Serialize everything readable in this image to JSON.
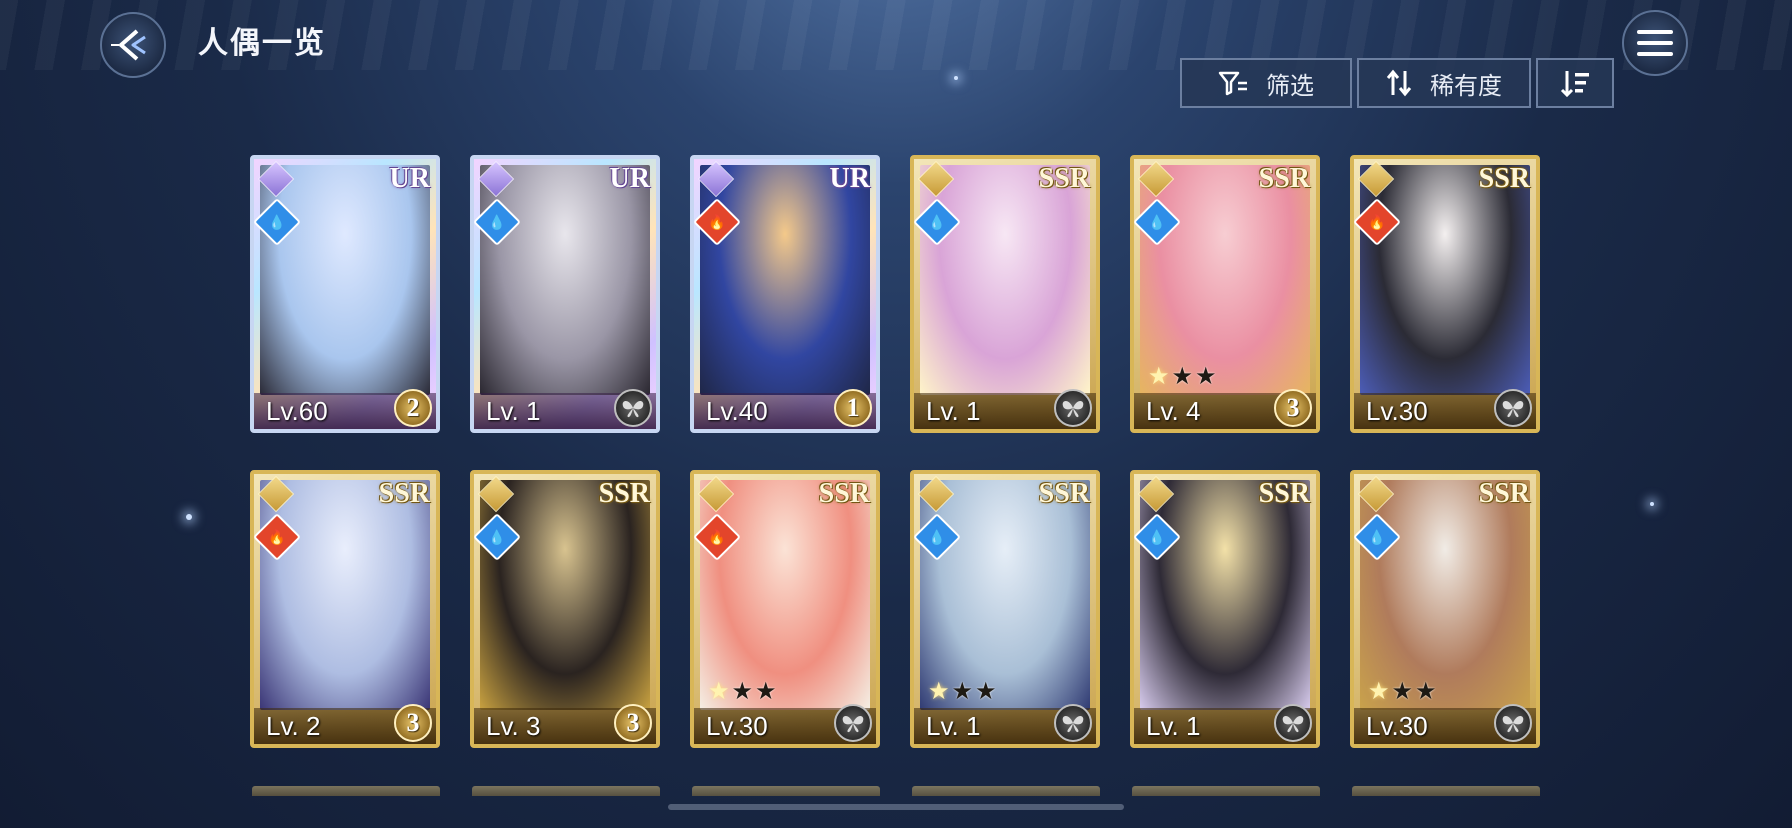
{
  "header": {
    "title": "人偶一览"
  },
  "toolbar": {
    "filter_label": "筛选",
    "sort_label": "稀有度"
  },
  "colors": {
    "gold_frame": "#d8b657",
    "ur_frame": "#c7d6f2",
    "water": "#2f8ee8",
    "fire": "#e3452b"
  },
  "cards": [
    {
      "rarity": "UR",
      "element": "water",
      "level": "Lv.60",
      "emblem": "2",
      "stars": 0,
      "stars_lit": 0,
      "art": [
        "#dfe9ff",
        "#a9c6ee",
        "#2a2a36"
      ]
    },
    {
      "rarity": "UR",
      "element": "water",
      "level": "Lv. 1",
      "emblem": "",
      "stars": 0,
      "stars_lit": 0,
      "art": [
        "#e8e6ec",
        "#9a96a6",
        "#2a2730"
      ]
    },
    {
      "rarity": "UR",
      "element": "fire",
      "level": "Lv.40",
      "emblem": "1",
      "stars": 0,
      "stars_lit": 0,
      "art": [
        "#f4c98a",
        "#3146a1",
        "#1f2747"
      ]
    },
    {
      "rarity": "SSR",
      "element": "water",
      "level": "Lv. 1",
      "emblem": "",
      "stars": 0,
      "stars_lit": 0,
      "art": [
        "#f7e7f4",
        "#d9a4d7",
        "#fff5c9"
      ]
    },
    {
      "rarity": "SSR",
      "element": "water",
      "level": "Lv. 4",
      "emblem": "3",
      "stars": 3,
      "stars_lit": 1,
      "art": [
        "#f7cdd2",
        "#ea8fa2",
        "#e6b65f"
      ]
    },
    {
      "rarity": "SSR",
      "element": "fire",
      "level": "Lv.30",
      "emblem": "",
      "stars": 0,
      "stars_lit": 0,
      "art": [
        "#f4f0f0",
        "#2b2b35",
        "#4c5db8"
      ]
    },
    {
      "rarity": "SSR",
      "element": "fire",
      "level": "Lv. 2",
      "emblem": "3",
      "stars": 0,
      "stars_lit": 0,
      "art": [
        "#e9eefc",
        "#aebde2",
        "#3a3575"
      ]
    },
    {
      "rarity": "SSR",
      "element": "water",
      "level": "Lv. 3",
      "emblem": "3",
      "stars": 0,
      "stars_lit": 0,
      "art": [
        "#d8c38f",
        "#2a2320",
        "#c9a240"
      ]
    },
    {
      "rarity": "SSR",
      "element": "fire",
      "level": "Lv.30",
      "emblem": "",
      "stars": 3,
      "stars_lit": 1,
      "art": [
        "#fbe3d6",
        "#f08f80",
        "#f4efe4"
      ]
    },
    {
      "rarity": "SSR",
      "element": "water",
      "level": "Lv. 1",
      "emblem": "",
      "stars": 3,
      "stars_lit": 1,
      "art": [
        "#e6eef7",
        "#a9bfd6",
        "#2f3a72"
      ]
    },
    {
      "rarity": "SSR",
      "element": "water",
      "level": "Lv. 1",
      "emblem": "",
      "stars": 0,
      "stars_lit": 0,
      "art": [
        "#f3e1a8",
        "#2e2a36",
        "#d8ccee"
      ]
    },
    {
      "rarity": "SSR",
      "element": "water",
      "level": "Lv.30",
      "emblem": "",
      "stars": 3,
      "stars_lit": 1,
      "art": [
        "#f1ece6",
        "#b07b5c",
        "#c9a24b"
      ]
    }
  ]
}
